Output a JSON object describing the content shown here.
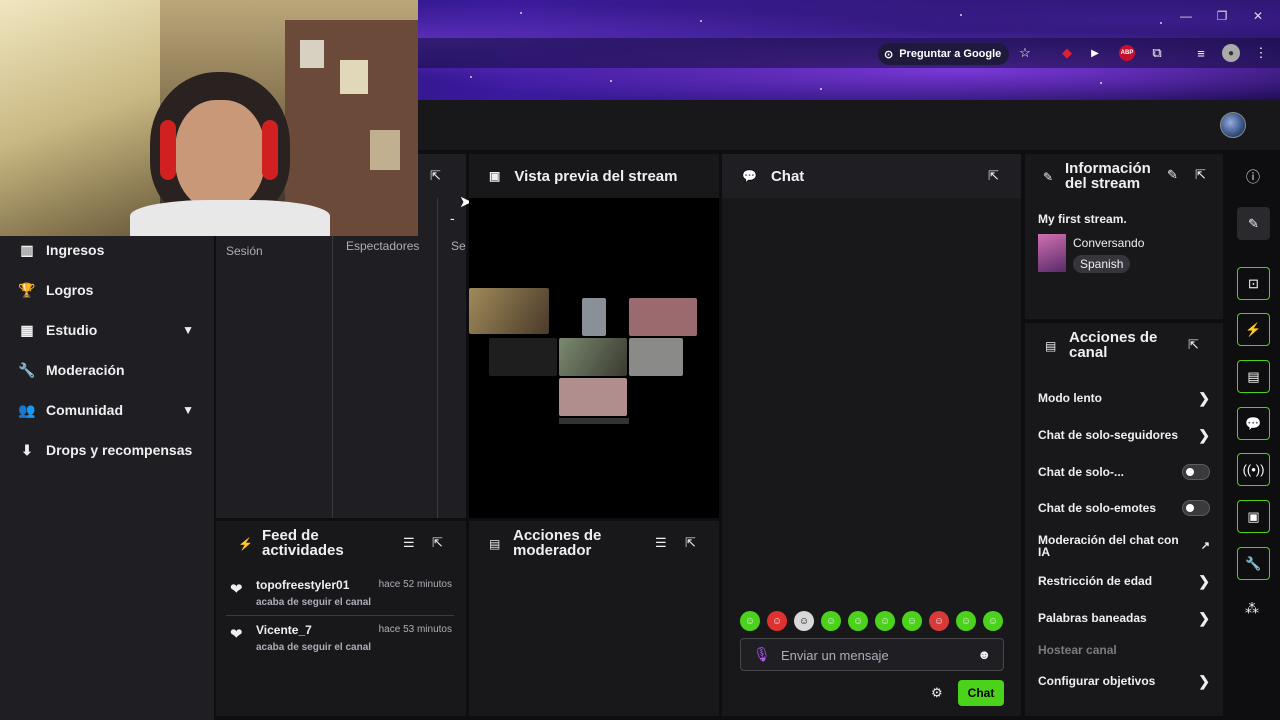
{
  "browser": {
    "ask_google": "Preguntar a Google",
    "abp_badge": "ABP",
    "colors": {
      "accent": "#4ad31a",
      "theme": "#3b1a9e"
    }
  },
  "nav": {
    "items": [
      {
        "label": "Ingresos",
        "icon": "revenue-icon"
      },
      {
        "label": "Logros",
        "icon": "trophy-icon"
      },
      {
        "label": "Estudio",
        "icon": "studio-icon",
        "expandable": true
      },
      {
        "label": "Moderación",
        "icon": "wrench-icon"
      },
      {
        "label": "Comunidad",
        "icon": "community-icon",
        "expandable": true
      },
      {
        "label": "Drops y recompensas",
        "icon": "drops-icon"
      }
    ]
  },
  "stats": {
    "dash": "-",
    "columns": [
      "Sesión",
      "Espectadores",
      "Se"
    ]
  },
  "preview": {
    "title": "Vista previa del stream"
  },
  "chat": {
    "title": "Chat",
    "placeholder": "Enviar un mensaje",
    "send_label": "Chat"
  },
  "info": {
    "title": "Información del stream",
    "stream_title": "My first stream.",
    "category": "Conversando",
    "language": "Spanish"
  },
  "actions": {
    "title": "Acciones de canal",
    "items": [
      {
        "label": "Modo lento",
        "control": "arrow"
      },
      {
        "label": "Chat de solo-seguidores",
        "control": "arrow"
      },
      {
        "label": "Chat de solo-...",
        "control": "toggle"
      },
      {
        "label": "Chat de solo-emotes",
        "control": "toggle"
      },
      {
        "label": "Moderación del chat con IA",
        "control": "external"
      },
      {
        "label": "Restricción de edad",
        "control": "arrow"
      },
      {
        "label": "Palabras baneadas",
        "control": "arrow"
      },
      {
        "label": "Hostear canal",
        "control": "disabled"
      },
      {
        "label": "Configurar objetivos",
        "control": "arrow"
      }
    ]
  },
  "feed": {
    "title": "Feed de actividades",
    "events": [
      {
        "user": "topofreestyler01",
        "time": "hace 52 minutos",
        "action": "acaba de seguir el canal"
      },
      {
        "user": "Vicente_7",
        "time": "hace 53 minutos",
        "action": "acaba de seguir el canal"
      }
    ]
  },
  "mod_actions": {
    "title": "Acciones de moderador"
  }
}
